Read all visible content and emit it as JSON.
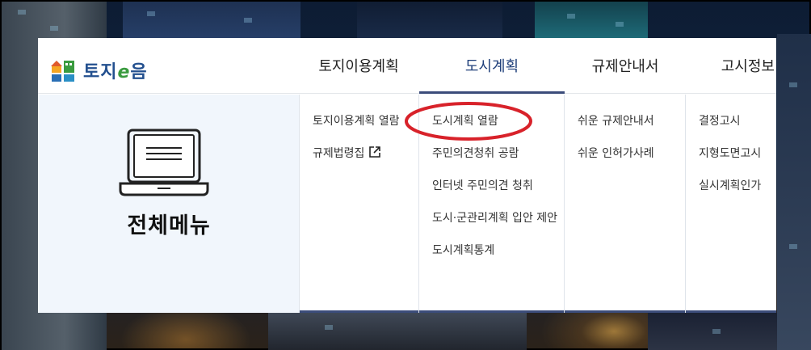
{
  "logo": {
    "text_main": "토지",
    "text_e": "e",
    "text_end": "음",
    "icon": "land-logo-icon"
  },
  "nav": {
    "tabs": [
      {
        "label": "토지이용계획",
        "active": false
      },
      {
        "label": "도시계획",
        "active": true
      },
      {
        "label": "규제안내서",
        "active": false
      },
      {
        "label": "고시정보",
        "active": false
      }
    ]
  },
  "all_menu": {
    "title": "전체메뉴",
    "icon": "laptop-icon"
  },
  "columns": [
    {
      "items": [
        "토지이용계획 열람",
        "규제법령집"
      ],
      "external_icon": "external-link-icon"
    },
    {
      "items": [
        "도시계획 열람",
        "주민의견청취 공람",
        "인터넷 주민의견 청취",
        "도시·군관리계획 입안 제안",
        "도시계획통계"
      ]
    },
    {
      "items": [
        "쉬운 규제안내서",
        "쉬운 인허가사례"
      ]
    },
    {
      "items": [
        "결정고시",
        "지형도면고시",
        "실시계획인가"
      ]
    }
  ],
  "colors": {
    "accent": "#3b4c7a",
    "highlight": "#d8222a",
    "panel_bg": "#f1f6fc"
  }
}
